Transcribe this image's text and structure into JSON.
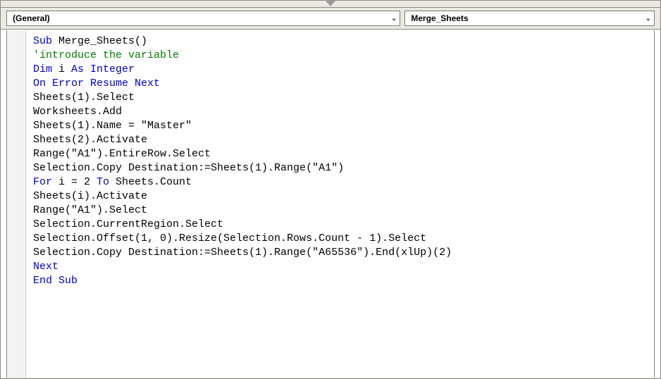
{
  "toolbar": {
    "object_dropdown": "(General)",
    "procedure_dropdown": "Merge_Sheets"
  },
  "code": {
    "lines": [
      {
        "tokens": [
          {
            "t": "Sub ",
            "c": "kw-blue"
          },
          {
            "t": "Merge_Sheets()",
            "c": "txt-black"
          }
        ]
      },
      {
        "tokens": [
          {
            "t": "'introduce the variable",
            "c": "comment-green"
          }
        ]
      },
      {
        "tokens": [
          {
            "t": "Dim ",
            "c": "kw-blue"
          },
          {
            "t": "i ",
            "c": "txt-black"
          },
          {
            "t": "As Integer",
            "c": "kw-blue"
          }
        ]
      },
      {
        "tokens": [
          {
            "t": "On Error Resume Next",
            "c": "kw-blue"
          }
        ]
      },
      {
        "tokens": [
          {
            "t": "Sheets(1).Select",
            "c": "txt-black"
          }
        ]
      },
      {
        "tokens": [
          {
            "t": "Worksheets.Add",
            "c": "txt-black"
          }
        ]
      },
      {
        "tokens": [
          {
            "t": "Sheets(1).Name = \"Master\"",
            "c": "txt-black"
          }
        ]
      },
      {
        "tokens": [
          {
            "t": "Sheets(2).Activate",
            "c": "txt-black"
          }
        ]
      },
      {
        "tokens": [
          {
            "t": "Range(\"A1\").EntireRow.Select",
            "c": "txt-black"
          }
        ]
      },
      {
        "tokens": [
          {
            "t": "Selection.Copy Destination:=Sheets(1).Range(\"A1\")",
            "c": "txt-black"
          }
        ]
      },
      {
        "tokens": [
          {
            "t": "For ",
            "c": "kw-blue"
          },
          {
            "t": "i = 2 ",
            "c": "txt-black"
          },
          {
            "t": "To ",
            "c": "kw-blue"
          },
          {
            "t": "Sheets.Count",
            "c": "txt-black"
          }
        ]
      },
      {
        "tokens": [
          {
            "t": "Sheets(i).Activate",
            "c": "txt-black"
          }
        ]
      },
      {
        "tokens": [
          {
            "t": "Range(\"A1\").Select",
            "c": "txt-black"
          }
        ]
      },
      {
        "tokens": [
          {
            "t": "Selection.CurrentRegion.Select",
            "c": "txt-black"
          }
        ]
      },
      {
        "tokens": [
          {
            "t": "Selection.Offset(1, 0).Resize(Selection.Rows.Count - 1).Select",
            "c": "txt-black"
          }
        ]
      },
      {
        "tokens": [
          {
            "t": "Selection.Copy Destination:=Sheets(1).Range(\"A65536\").End(xlUp)(2)",
            "c": "txt-black"
          }
        ]
      },
      {
        "tokens": [
          {
            "t": "Next",
            "c": "kw-blue"
          }
        ]
      },
      {
        "tokens": [
          {
            "t": "End Sub",
            "c": "kw-blue"
          }
        ]
      }
    ]
  }
}
